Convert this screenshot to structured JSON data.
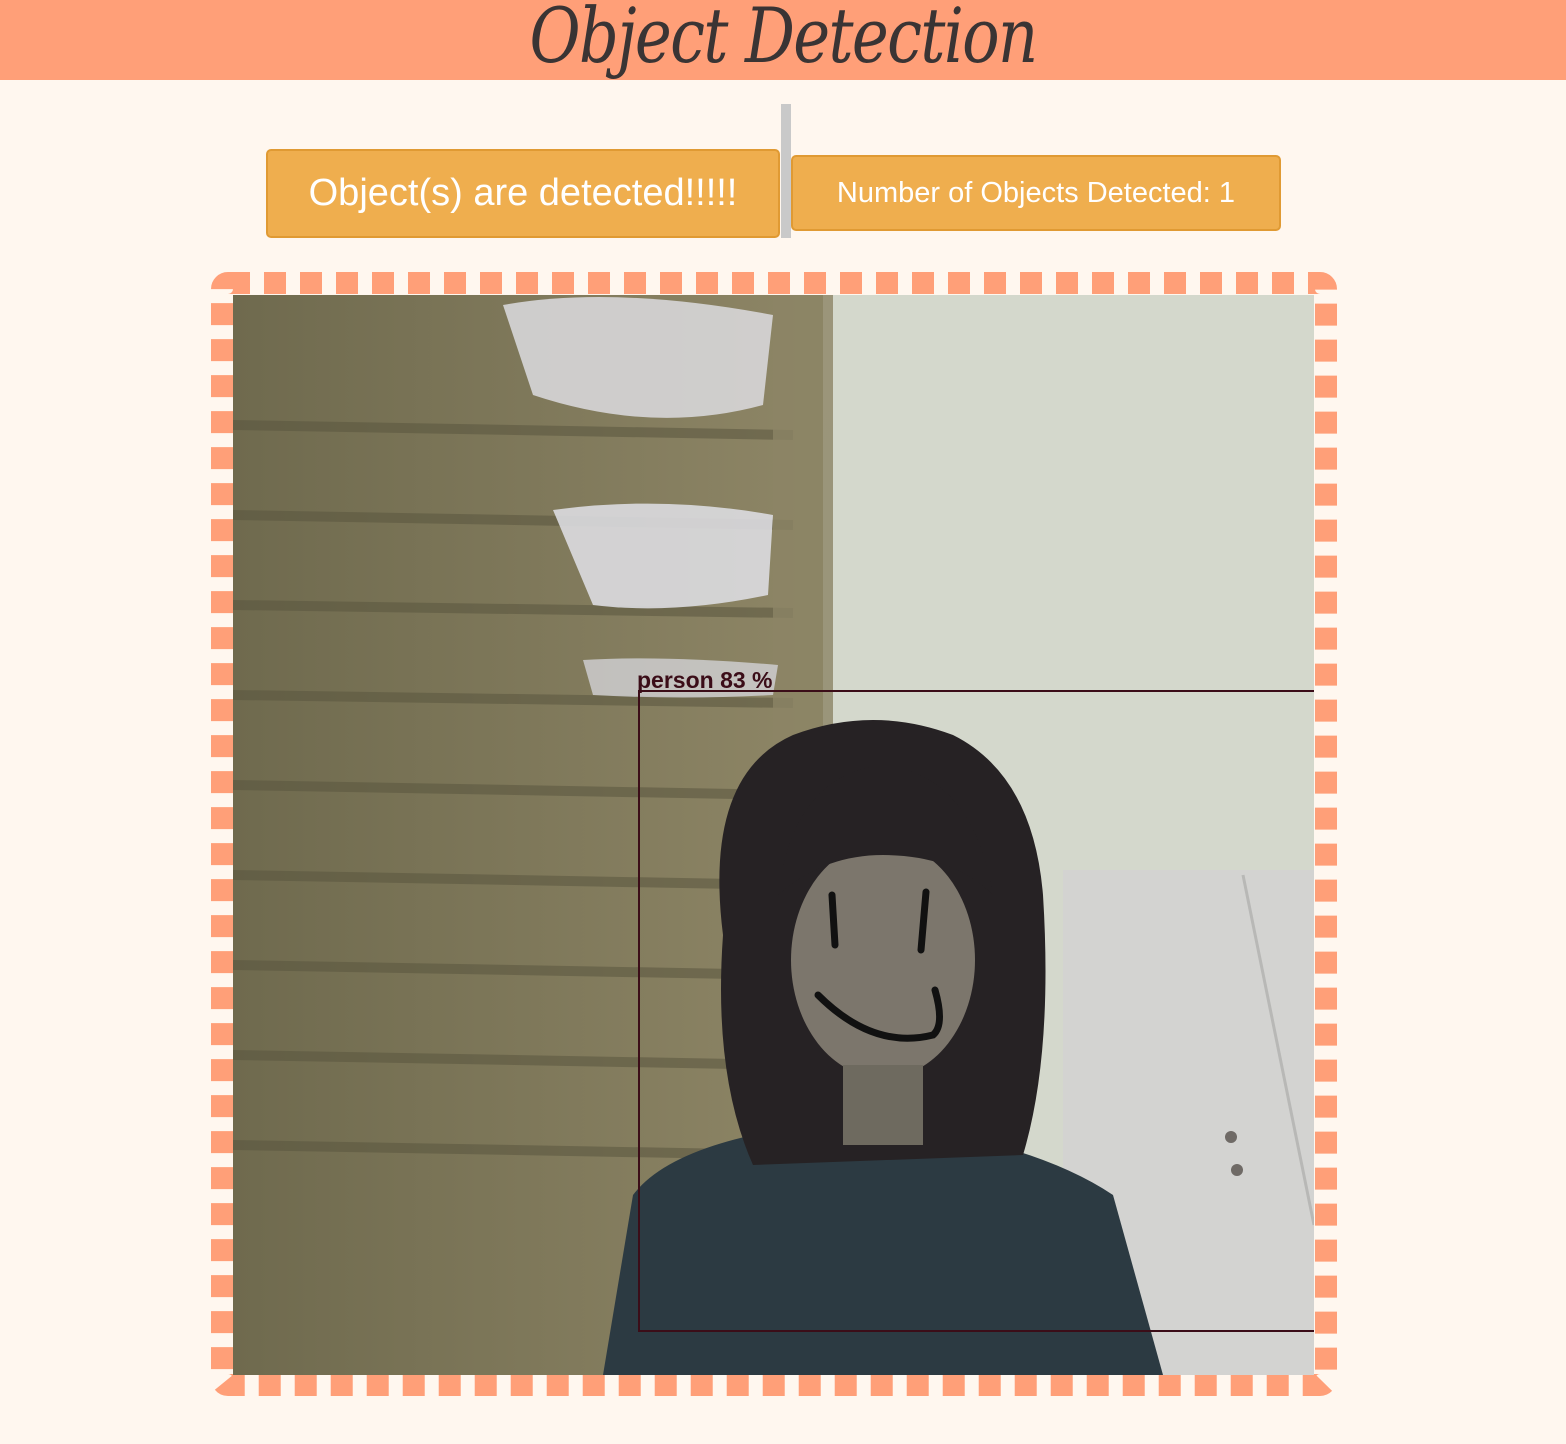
{
  "header": {
    "title": "Object Detection"
  },
  "status": {
    "message": "Object(s) are detected!!!!!",
    "count_label": "Number of Objects Detected: 1"
  },
  "detection": {
    "label": "person 83 %"
  },
  "colors": {
    "header_bg": "#ff9f78",
    "page_bg": "#fff7ef",
    "button_bg": "#efae4e",
    "frame_dash": "#ff9f78",
    "bbox": "#3b0d18"
  }
}
